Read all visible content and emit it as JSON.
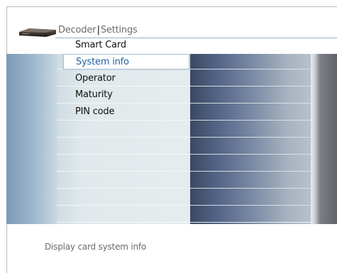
{
  "header": {
    "breadcrumb_root": "Decoder",
    "breadcrumb_separator": "|",
    "breadcrumb_current": "Settings",
    "menu_title": "Smart Card"
  },
  "menu": {
    "items": [
      {
        "label": "System info",
        "selected": true
      },
      {
        "label": "Operator",
        "selected": false
      },
      {
        "label": "Maturity",
        "selected": false
      },
      {
        "label": "PIN code",
        "selected": false
      }
    ]
  },
  "footer": {
    "help_text": "Display card system info"
  },
  "icons": {
    "decoder": "decoder-box-icon"
  },
  "colors": {
    "selected_text": "#1f5f9a",
    "accent_line": "#9ab0c6"
  }
}
